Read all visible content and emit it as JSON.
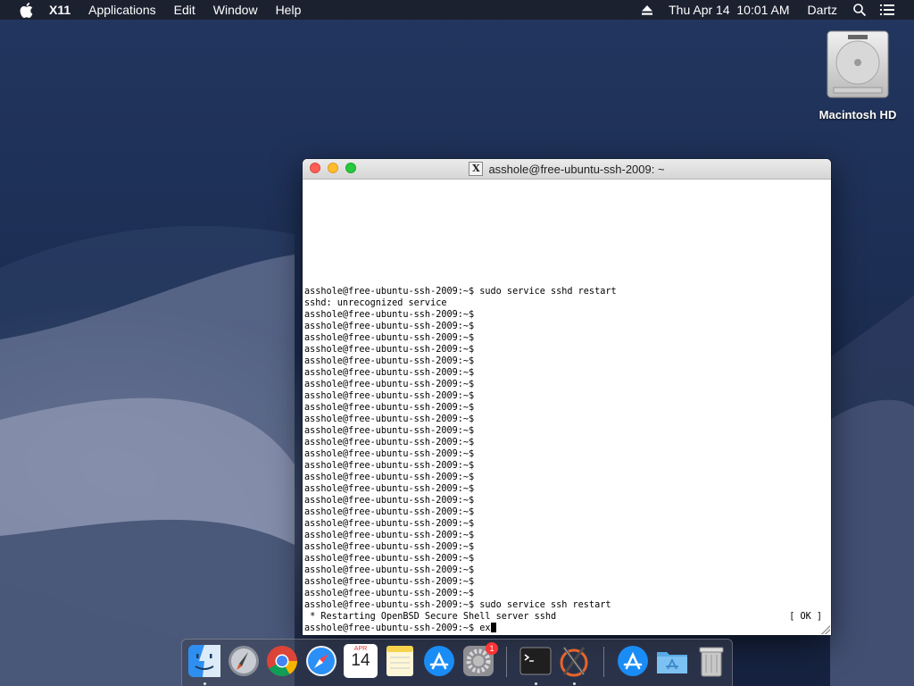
{
  "menubar": {
    "app_name": "X11",
    "menus": [
      "Applications",
      "Edit",
      "Window",
      "Help"
    ],
    "datetime": "Thu Apr 14  10:01 AM",
    "user": "Dartz",
    "icons": [
      "apple-icon",
      "eject-icon",
      "search-icon",
      "list-icon"
    ]
  },
  "desktop": {
    "icon_label": "Macintosh HD"
  },
  "window": {
    "title": "asshole@free-ubuntu-ssh-2009: ~",
    "badge": "X",
    "lines": [
      "asshole@free-ubuntu-ssh-2009:~$ sudo service sshd restart",
      "sshd: unrecognized service",
      "asshole@free-ubuntu-ssh-2009:~$",
      "asshole@free-ubuntu-ssh-2009:~$",
      "asshole@free-ubuntu-ssh-2009:~$",
      "asshole@free-ubuntu-ssh-2009:~$",
      "asshole@free-ubuntu-ssh-2009:~$",
      "asshole@free-ubuntu-ssh-2009:~$",
      "asshole@free-ubuntu-ssh-2009:~$",
      "asshole@free-ubuntu-ssh-2009:~$",
      "asshole@free-ubuntu-ssh-2009:~$",
      "asshole@free-ubuntu-ssh-2009:~$",
      "asshole@free-ubuntu-ssh-2009:~$",
      "asshole@free-ubuntu-ssh-2009:~$",
      "asshole@free-ubuntu-ssh-2009:~$",
      "asshole@free-ubuntu-ssh-2009:~$",
      "asshole@free-ubuntu-ssh-2009:~$",
      "asshole@free-ubuntu-ssh-2009:~$",
      "asshole@free-ubuntu-ssh-2009:~$",
      "asshole@free-ubuntu-ssh-2009:~$",
      "asshole@free-ubuntu-ssh-2009:~$",
      "asshole@free-ubuntu-ssh-2009:~$",
      "asshole@free-ubuntu-ssh-2009:~$",
      "asshole@free-ubuntu-ssh-2009:~$",
      "asshole@free-ubuntu-ssh-2009:~$",
      "asshole@free-ubuntu-ssh-2009:~$",
      "asshole@free-ubuntu-ssh-2009:~$",
      "asshole@free-ubuntu-ssh-2009:~$ sudo service ssh restart",
      " * Restarting OpenBSD Secure Shell server sshd"
    ],
    "ok_status": "[ OK ]",
    "current_prompt": "asshole@free-ubuntu-ssh-2009:~$ ex"
  },
  "dock": {
    "calendar_month": "APR",
    "calendar_day": "14",
    "badge_count": "1",
    "items": [
      "finder-icon",
      "launchpad-icon",
      "chrome-icon",
      "safari-icon",
      "calendar-icon",
      "notes-icon",
      "app-store-icon",
      "system-preferences-icon",
      "terminal-icon",
      "x11-icon",
      "app-store-icon",
      "applications-folder-icon",
      "trash-icon"
    ]
  },
  "colors": {
    "menubar_bg": "#1c202c",
    "close": "#fd5f57",
    "minimize": "#febc2e",
    "maximize": "#28c840"
  }
}
